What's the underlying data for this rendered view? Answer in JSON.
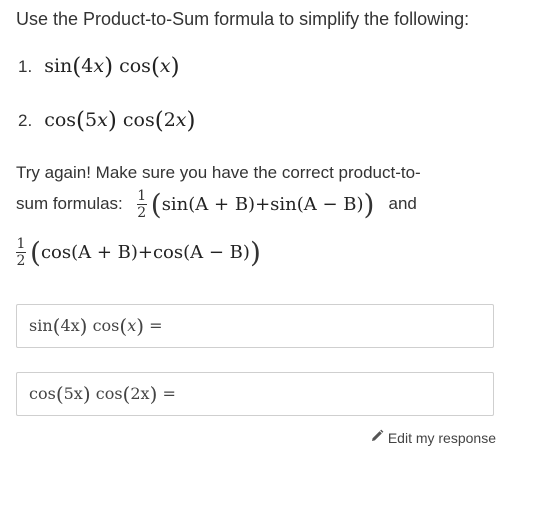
{
  "prompt": "Use the Product-to-Sum formula to simplify the following:",
  "problems": [
    {
      "number": "1.",
      "fn1": "sin",
      "arg1_coef": "4",
      "arg1_var": "x",
      "fn2": "cos",
      "arg2_coef": "",
      "arg2_var": "x"
    },
    {
      "number": "2.",
      "fn1": "cos",
      "arg1_coef": "5",
      "arg1_var": "x",
      "fn2": "cos",
      "arg2_coef": "2",
      "arg2_var": "x"
    }
  ],
  "hint": {
    "line1": "Try again! Make sure you have the correct product-to-",
    "line2": "sum formulas:",
    "and": "and",
    "frac_num": "1",
    "frac_den": "2",
    "formula1": "sin(A + B)+sin(A − B)",
    "formula2": "cos(A + B)+cos(A − B)"
  },
  "answers": [
    {
      "fn1": "sin",
      "arg1": "4x",
      "fn2": "cos",
      "arg2": "x",
      "equals": "="
    },
    {
      "fn1": "cos",
      "arg1": "5x",
      "fn2": "cos",
      "arg2": "2x",
      "equals": "="
    }
  ],
  "edit_link": {
    "label": "Edit my response",
    "icon": "pencil-icon"
  }
}
